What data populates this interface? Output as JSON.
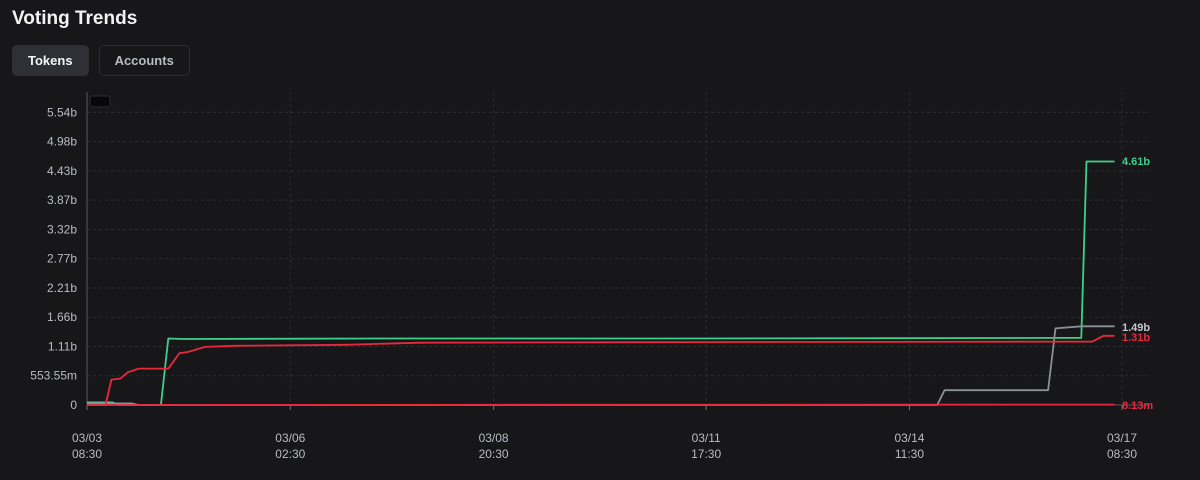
{
  "header": {
    "title": "Voting Trends"
  },
  "tabs": [
    {
      "label": "Tokens",
      "active": true
    },
    {
      "label": "Accounts",
      "active": false
    }
  ],
  "colors": {
    "green": "#3ecf8e",
    "gray": "#8a8f98",
    "red": "#e8283c",
    "background": "#17171a",
    "grid": "#2a2c31"
  },
  "chart_data": {
    "type": "line",
    "grid": true,
    "yticks": [
      "0",
      "553.55m",
      "1.11b",
      "1.66b",
      "2.21b",
      "2.77b",
      "3.32b",
      "3.87b",
      "4.43b",
      "4.98b",
      "5.54b"
    ],
    "ylim": [
      0,
      5.54
    ],
    "yunit": "billions",
    "xticks": [
      {
        "date": "03/03",
        "time": "08:30",
        "day": 0
      },
      {
        "date": "03/06",
        "time": "02:30",
        "day": 2.75
      },
      {
        "date": "03/08",
        "time": "20:30",
        "day": 5.5
      },
      {
        "date": "03/11",
        "time": "17:30",
        "day": 8.375
      },
      {
        "date": "03/14",
        "time": "11:30",
        "day": 11.125
      },
      {
        "date": "03/17",
        "time": "08:30",
        "day": 14
      }
    ],
    "series": [
      {
        "color": "#3ecf8e",
        "end_label": "4.61b",
        "points": [
          [
            0,
            0.05
          ],
          [
            0.35,
            0.05
          ],
          [
            0.42,
            0.0
          ],
          [
            1.0,
            0.0
          ],
          [
            1.1,
            1.26
          ],
          [
            1.3,
            1.25
          ],
          [
            4.0,
            1.26
          ],
          [
            8.0,
            1.26
          ],
          [
            13.3,
            1.27
          ],
          [
            13.45,
            1.27
          ],
          [
            13.52,
            4.61
          ],
          [
            13.9,
            4.61
          ]
        ]
      },
      {
        "color": "#8a8f98",
        "end_label": "1.49b",
        "points": [
          [
            0,
            0.03
          ],
          [
            0.6,
            0.03
          ],
          [
            0.7,
            0.0
          ],
          [
            11.5,
            0.0
          ],
          [
            11.6,
            0.28
          ],
          [
            13.0,
            0.28
          ],
          [
            13.1,
            1.45
          ],
          [
            13.45,
            1.49
          ],
          [
            13.9,
            1.49
          ]
        ]
      },
      {
        "color": "#e8283c",
        "end_label": "1.31b",
        "points": [
          [
            0,
            0.0
          ],
          [
            0.25,
            0.0
          ],
          [
            0.33,
            0.48
          ],
          [
            0.45,
            0.5
          ],
          [
            0.55,
            0.62
          ],
          [
            0.7,
            0.69
          ],
          [
            1.1,
            0.69
          ],
          [
            1.25,
            0.98
          ],
          [
            1.35,
            1.0
          ],
          [
            1.6,
            1.1
          ],
          [
            2.0,
            1.12
          ],
          [
            3.5,
            1.14
          ],
          [
            4.5,
            1.18
          ],
          [
            8.0,
            1.19
          ],
          [
            13.6,
            1.2
          ],
          [
            13.75,
            1.31
          ],
          [
            13.9,
            1.31
          ]
        ]
      },
      {
        "color": "#e8283c",
        "end_label": "8.13m",
        "points": [
          [
            0,
            0.0
          ],
          [
            13.9,
            0.008
          ]
        ]
      }
    ]
  }
}
